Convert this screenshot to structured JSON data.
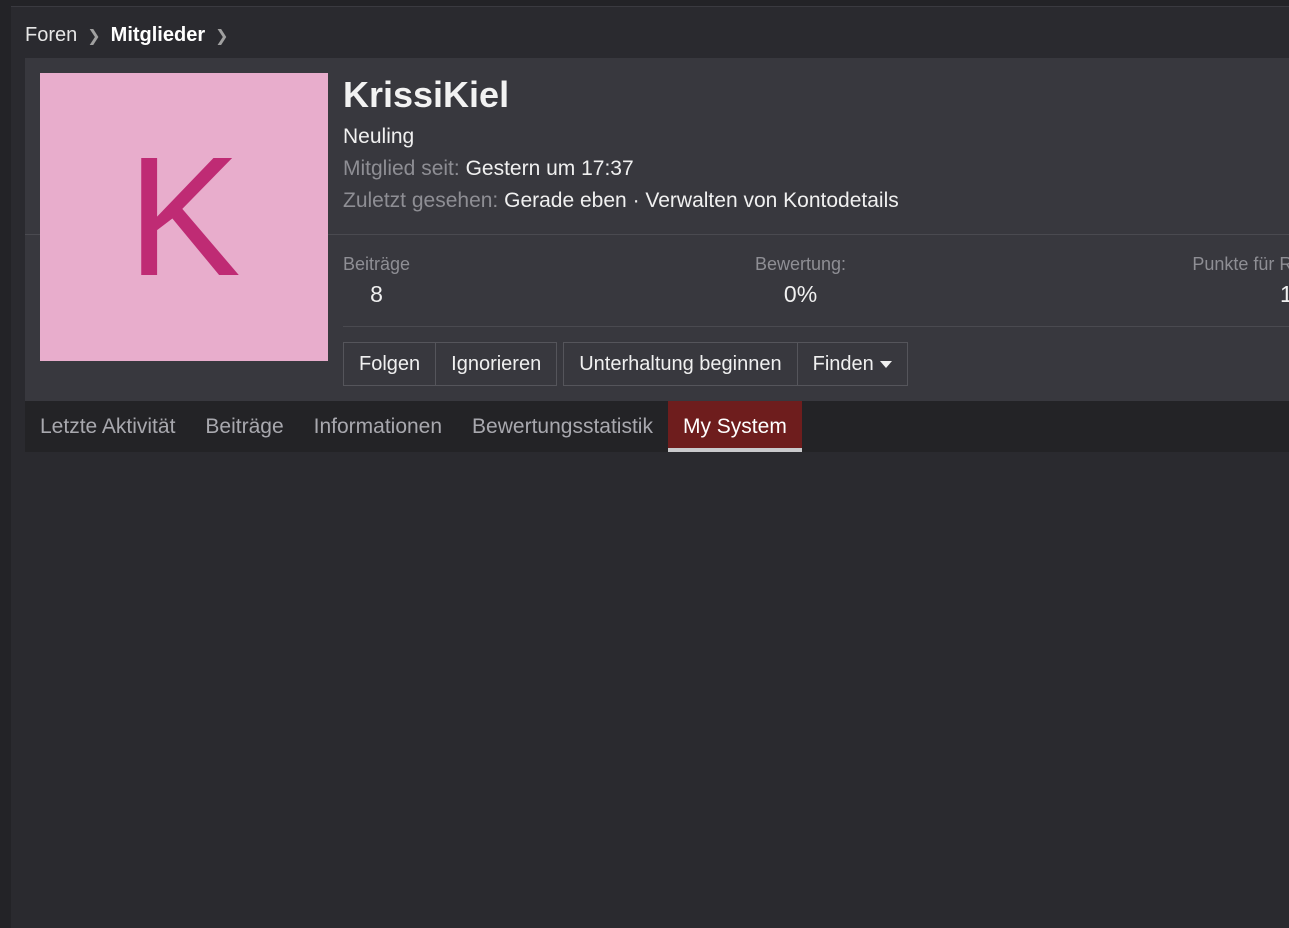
{
  "breadcrumb": {
    "items": [
      "Foren",
      "Mitglieder"
    ],
    "separator": ">"
  },
  "profile": {
    "avatar_letter": "K",
    "avatar_bg": "#e8adcc",
    "avatar_fg": "#bf2b74",
    "username": "KrissiKiel",
    "rank": "Neuling",
    "member_since_label": "Mitglied seit:",
    "member_since_value": "Gestern um 17:37",
    "last_seen_label": "Zuletzt gesehen:",
    "last_seen_value": "Gerade eben",
    "last_seen_separator": "·",
    "manage_account_link": "Verwalten von Kontodetails"
  },
  "stats": [
    {
      "label": "Beiträge",
      "value": "8"
    },
    {
      "label": "Bewertung:",
      "value": "0%"
    },
    {
      "label": "Punkte für R",
      "value": "1"
    }
  ],
  "actions": {
    "follow": "Folgen",
    "ignore": "Ignorieren",
    "start_conversation": "Unterhaltung beginnen",
    "find": "Finden"
  },
  "tabs": [
    {
      "label": "Letzte Aktivität",
      "active": false
    },
    {
      "label": "Beiträge",
      "active": false
    },
    {
      "label": "Informationen",
      "active": false
    },
    {
      "label": "Bewertungsstatistik",
      "active": false
    },
    {
      "label": "My System",
      "active": true
    }
  ],
  "colors": {
    "background": "#2a2a2f",
    "card": "#38383e",
    "tab_bar": "#232326",
    "active_tab": "#6e1d1d"
  }
}
